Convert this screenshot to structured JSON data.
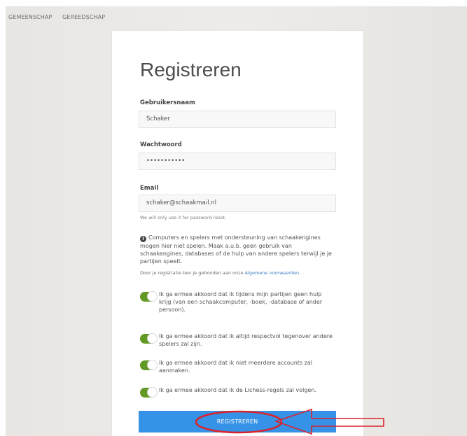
{
  "nav": {
    "items": [
      "GEMEENSCHAP",
      "GEREEDSCHAP"
    ]
  },
  "form": {
    "title": "Registreren",
    "username": {
      "label": "Gebruikersnaam",
      "value": "Schaker"
    },
    "password": {
      "label": "Wachtwoord",
      "value": "•••••••••••"
    },
    "email": {
      "label": "Email",
      "value": "schaker@schaakmail.nl",
      "help": "We will only use it for password reset."
    },
    "info": "Computers en spelers met ondersteuning van schaakengines mogen hier niet spelen. Maak a.u.b. geen gebruik van schaakengines, databases of de hulp van andere spelers terwijl je je partijen speelt.",
    "terms_prefix": "Door je registratie ben je gebonden aan onze ",
    "terms_link": "Algemene voorwaarden",
    "terms_suffix": ".",
    "agreements": [
      "Ik ga ermee akkoord dat ik tijdens mijn partijen geen hulp krijg (van een schaakcomputer, -boek, -database of ander persoon).",
      "Ik ga ermee akkoord dat ik altijd respectvol tegenover andere spelers zal zijn.",
      "Ik ga ermee akkoord dat ik niet meerdere accounts zal aanmaken.",
      "Ik ga ermee akkoord dat ik de Lichess-regels zal volgen."
    ],
    "submit_label": "REGISTREREN"
  },
  "colors": {
    "accent": "#3692e7",
    "toggle_on": "#629924",
    "annotation": "#d9232b"
  }
}
